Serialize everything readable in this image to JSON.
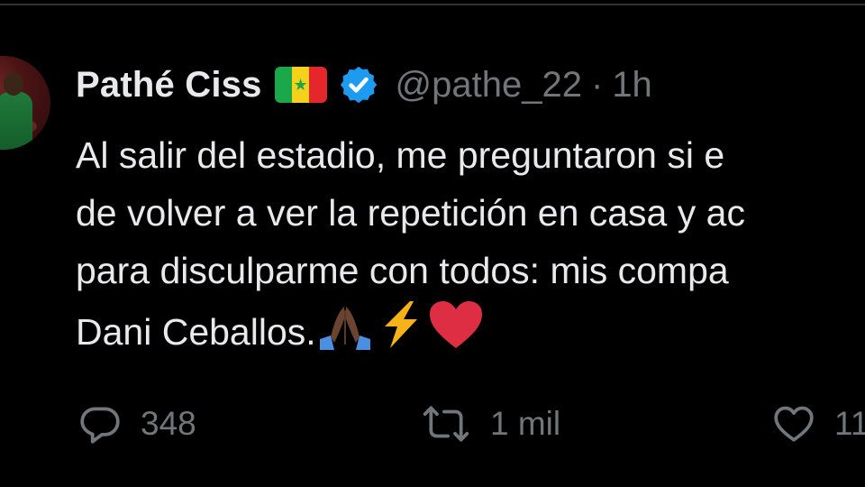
{
  "tweet": {
    "author": {
      "display_name": "Pathé Ciss",
      "handle": "@pathe_22",
      "flag": "senegal-flag",
      "verified": true
    },
    "separator": "·",
    "time": "1h",
    "text_lines": [
      "Al salir del estadio, me preguntaron si e",
      "de volver a ver la repetición en casa y ac",
      "para disculparme con todos: mis compa",
      "Dani Ceballos."
    ],
    "emojis": [
      "folded-hands-dark-skin",
      "lightning-bolt",
      "red-heart"
    ],
    "stats": {
      "replies": "348",
      "retweets": "1 mil",
      "likes": "11"
    }
  },
  "colors": {
    "background": "#000000",
    "text_primary": "#e7e9ea",
    "text_secondary": "#71767b",
    "verified_blue": "#1d9bf0",
    "divider": "#2f3336"
  },
  "icons": {
    "reply": "reply-icon",
    "retweet": "retweet-icon",
    "like": "heart-icon",
    "verified": "verified-badge-icon"
  }
}
